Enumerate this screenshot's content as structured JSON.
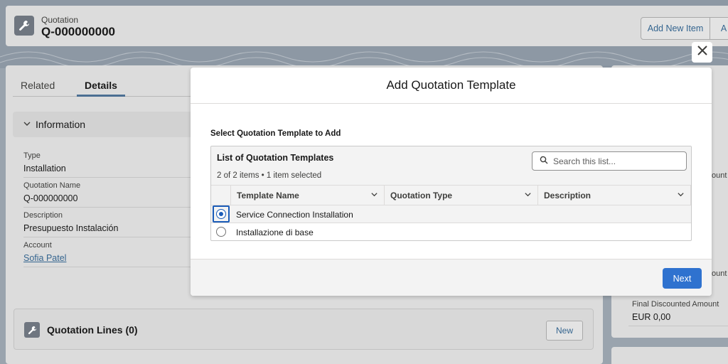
{
  "record": {
    "object_label": "Quotation",
    "name": "Q-000000000",
    "actions": [
      "Add New Item",
      "A"
    ]
  },
  "tabs": [
    {
      "label": "Related"
    },
    {
      "label": "Details"
    }
  ],
  "information": {
    "section_label": "Information",
    "fields": [
      {
        "label": "Type",
        "value": "Installation"
      },
      {
        "label": "Quotation Name",
        "value": "Q-000000000"
      },
      {
        "label": "Description",
        "value": "Presupuesto Instalación"
      },
      {
        "label": "Account",
        "value": "Sofia Patel"
      }
    ]
  },
  "quotation_lines": {
    "title": "Quotation Lines (0)",
    "new_label": "New"
  },
  "right_panel": {
    "fragment_1": "ount",
    "fragment_2": "ount",
    "final_label": "Final Discounted Amount",
    "final_value": "EUR 0,00"
  },
  "modal": {
    "title": "Add Quotation Template",
    "select_label": "Select Quotation Template to Add",
    "list_title": "List of Quotation Templates",
    "list_meta": "2 of 2 items • 1 item selected",
    "search_placeholder": "Search this list...",
    "columns": [
      "Template Name",
      "Quotation Type",
      "Description"
    ],
    "rows": [
      {
        "template_name": "Service Connection Installation",
        "selected": true
      },
      {
        "template_name": "Installazione di base",
        "selected": false
      }
    ],
    "next_label": "Next"
  }
}
